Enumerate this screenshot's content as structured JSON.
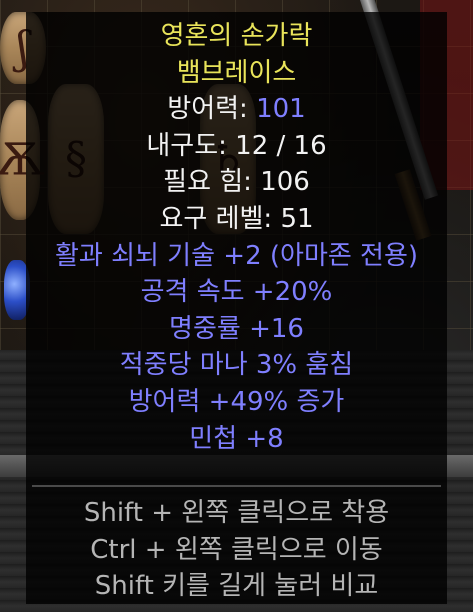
{
  "tooltip": {
    "name_line1": "영혼의 손가락",
    "name_line2": "뱀브레이스",
    "stats": {
      "defense_label": "방어력: ",
      "defense_value": "101",
      "durability": "내구도: 12 / 16",
      "req_str": "필요 힘: 106",
      "req_level": "요구 레벨: 51"
    },
    "mods": [
      "활과 쇠뇌 기술 +2 (아마존 전용)",
      "공격 속도 +20%",
      "명중률 +16",
      "적중당 마나 3% 훔침",
      "방어력 +49% 증가",
      "민첩 +8"
    ],
    "hints": [
      "Shift + 왼쪽 클릭으로 착용",
      "Ctrl + 왼쪽 클릭으로 이동",
      "Shift 키를 길게 눌러 비교"
    ]
  },
  "colors": {
    "unique_gold": "#e9e45a",
    "magic_blue": "#7f7fff",
    "base_white": "#f2f2f2",
    "hint_gray": "#b5b5b5"
  }
}
